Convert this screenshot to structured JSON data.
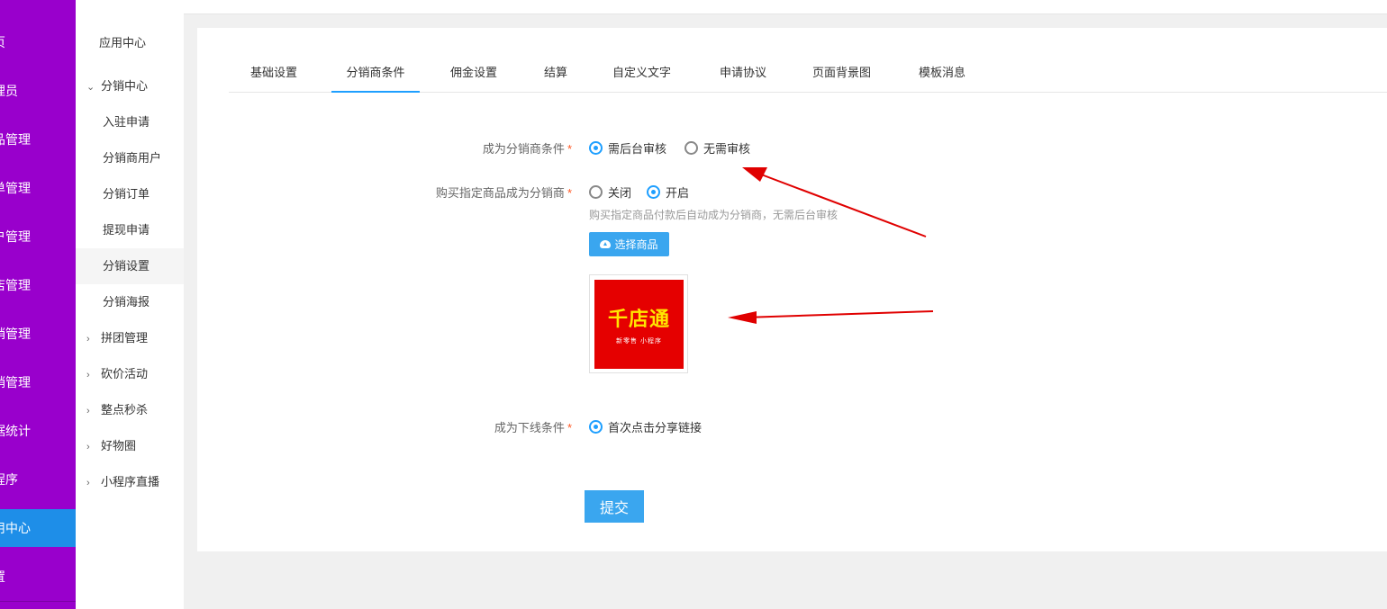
{
  "main_sidebar": {
    "items": [
      {
        "label": "页"
      },
      {
        "label": "理员"
      },
      {
        "label": "品管理"
      },
      {
        "label": "单管理"
      },
      {
        "label": "户管理"
      },
      {
        "label": "店管理"
      },
      {
        "label": "销管理"
      },
      {
        "label": "销管理"
      },
      {
        "label": "据统计"
      },
      {
        "label": "程序"
      },
      {
        "label": "用中心"
      },
      {
        "label": "置"
      }
    ],
    "active_color": "#1e8ee8",
    "bg_color": "#9900cc"
  },
  "sub_sidebar": {
    "title": "应用中心",
    "items": [
      {
        "label": "分销中心",
        "icon": "chevron-down-icon"
      },
      {
        "label": "入驻申请"
      },
      {
        "label": "分销商用户"
      },
      {
        "label": "分销订单"
      },
      {
        "label": "提现申请"
      },
      {
        "label": "分销设置"
      },
      {
        "label": "分销海报"
      },
      {
        "label": "拼团管理",
        "icon": "chevron-right-icon"
      },
      {
        "label": "砍价活动",
        "icon": "chevron-right-icon"
      },
      {
        "label": "整点秒杀",
        "icon": "chevron-right-icon"
      },
      {
        "label": "好物圈",
        "icon": "chevron-right-icon"
      },
      {
        "label": "小程序直播",
        "icon": "chevron-right-icon"
      }
    ]
  },
  "tabs": [
    {
      "label": "基础设置"
    },
    {
      "label": "分销商条件"
    },
    {
      "label": "佣金设置"
    },
    {
      "label": "结算"
    },
    {
      "label": "自定义文字"
    },
    {
      "label": "申请协议"
    },
    {
      "label": "页面背景图"
    },
    {
      "label": "模板消息"
    }
  ],
  "form": {
    "condition_label": "成为分销商条件",
    "condition_options": [
      {
        "label": "需后台审核",
        "selected": true
      },
      {
        "label": "无需审核",
        "selected": false
      }
    ],
    "buy_label": "购买指定商品成为分销商",
    "buy_options": [
      {
        "label": "关闭",
        "selected": false
      },
      {
        "label": "开启",
        "selected": true
      }
    ],
    "buy_tip": "购买指定商品付款后自动成为分销商，无需后台审核",
    "select_button": "选择商品",
    "product_logo": {
      "main": "千店通",
      "sub": "新零售 小程序"
    },
    "downline_label": "成为下线条件",
    "downline_options": [
      {
        "label": "首次点击分享链接",
        "selected": true
      }
    ],
    "required_mark": "*",
    "submit": "提交"
  },
  "colors": {
    "accent": "#1e9fff",
    "button": "#3aa6ef",
    "required": "#ff5722",
    "annotation_arrow": "#e00000"
  }
}
